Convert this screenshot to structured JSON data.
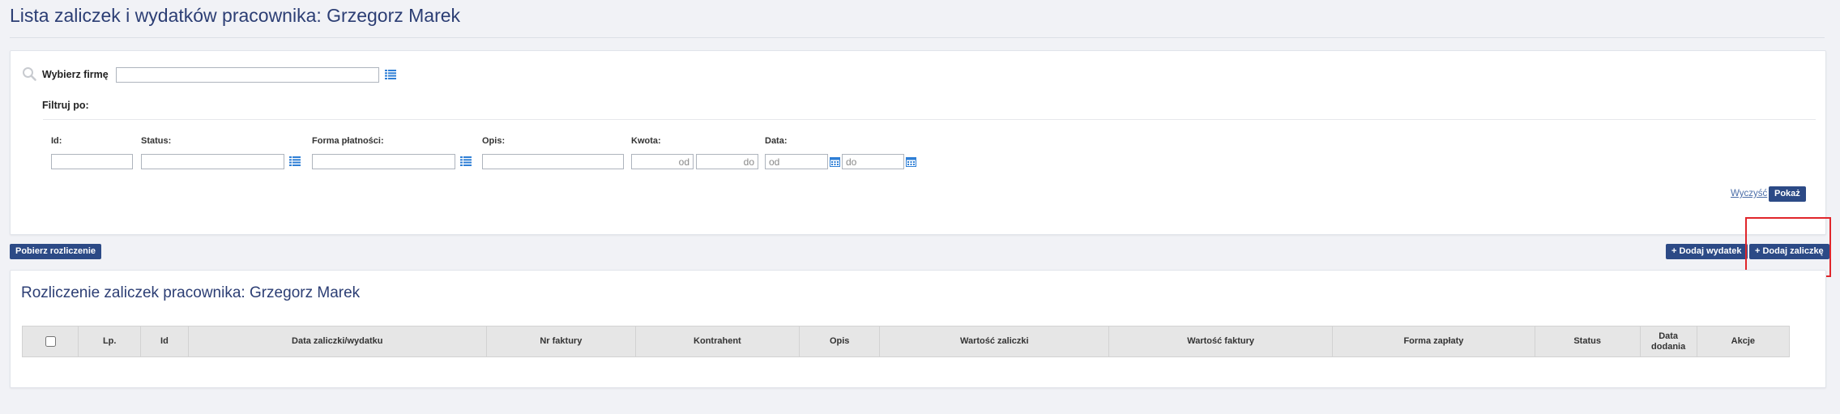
{
  "page": {
    "title": "Lista zaliczek i wydatków pracownika: Grzegorz Marek"
  },
  "filter": {
    "company_label": "Wybierz firmę",
    "company_value": "",
    "filter_by_label": "Filtruj po:",
    "fields": {
      "id": {
        "label": "Id:",
        "value": ""
      },
      "status": {
        "label": "Status:",
        "value": ""
      },
      "payment_form": {
        "label": "Forma płatności:",
        "value": ""
      },
      "description": {
        "label": "Opis:",
        "value": ""
      },
      "amount": {
        "label": "Kwota:",
        "from_placeholder": "od",
        "to_placeholder": "do"
      },
      "date": {
        "label": "Data:",
        "from_placeholder": "od",
        "to_placeholder": "do"
      }
    },
    "clear_label": "Wyczyść",
    "show_label": "Pokaż"
  },
  "toolbar": {
    "download_label": "Pobierz rozliczenie",
    "add_expense_label": "+ Dodaj wydatek",
    "add_advance_label": "+ Dodaj zaliczkę"
  },
  "list": {
    "title": "Rozliczenie zaliczek pracownika: Grzegorz Marek",
    "columns": {
      "lp": "Lp.",
      "id": "Id",
      "date": "Data zaliczki/wydatku",
      "invoice_no": "Nr faktury",
      "contractor": "Kontrahent",
      "description": "Opis",
      "advance_value": "Wartość zaliczki",
      "invoice_value": "Wartość faktury",
      "payment_form": "Forma zapłaty",
      "status": "Status",
      "date_added_line1": "Data",
      "date_added_line2": "dodania",
      "actions": "Akcje"
    }
  },
  "icons": {
    "search": "search-icon",
    "list": "list-icon",
    "calendar": "calendar-icon"
  },
  "colors": {
    "title": "#2c3e74",
    "button": "#2c4a86",
    "icon_blue": "#2f7fd6",
    "highlight": "#e0262b",
    "background": "#f1f2f6"
  }
}
